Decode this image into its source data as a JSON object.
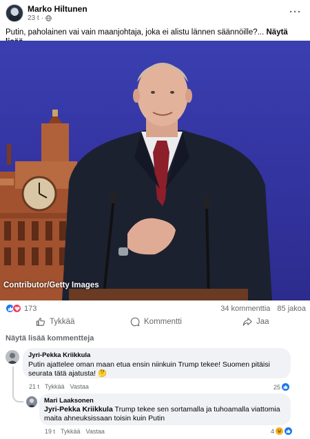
{
  "post": {
    "author": "Marko Hiltunen",
    "time": "23 t",
    "text": "Putin, paholainen vai vain maanjohtaja, joka ei alistu lännen säännöille?...",
    "see_more": "Näytä lisää",
    "photo_credit": "Contributor/Getty Images"
  },
  "stats": {
    "reaction_count": "173",
    "comments": "34 kommenttia",
    "shares": "85 jakoa"
  },
  "actions": {
    "like": "Tykkää",
    "comment": "Kommentti",
    "share": "Jaa"
  },
  "comments_section": {
    "view_more": "Näytä lisää kommentteja",
    "comments": [
      {
        "name": "Jyri-Pekka Kriikkula",
        "text_line1": "Putin ajattelee oman maan etua ensin niinkuin Trump tekee! Suomen pitäisi",
        "text_line2": "seurata tätä ajatusta! 🤔",
        "time": "21 t",
        "like": "Tykkää",
        "reply": "Vastaa",
        "reactions": "25"
      },
      {
        "name": "Mari Laaksonen",
        "tag": "Jyri-Pekka Kriikkula",
        "text_line1": " Trump tekee sen sortamalla ja tuhoamalla viattomia",
        "text_line2": "maita ahneuksissaan toisin kuin Putin",
        "time": "19 t",
        "like": "Tykkää",
        "reply": "Vastaa",
        "reactions": "4"
      }
    ]
  },
  "colors": {
    "facebook_blue": "#1877f2",
    "love_red": "#f33e58",
    "secondary_text": "#65676b",
    "bubble_bg": "#f0f2f5"
  }
}
